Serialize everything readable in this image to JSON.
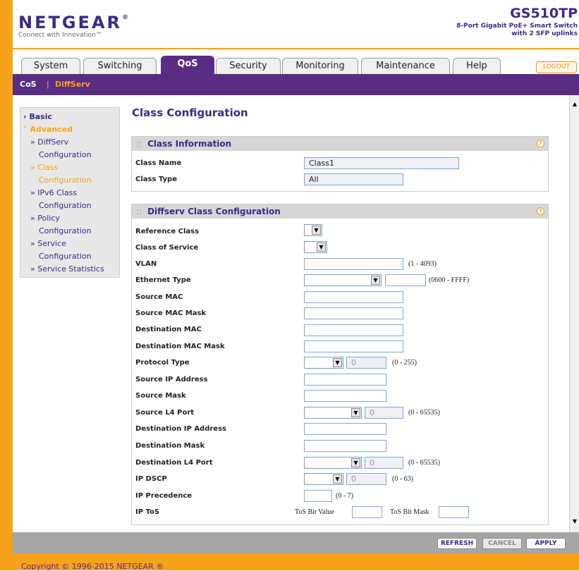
{
  "brand": {
    "logo": "NETGEAR",
    "reg": "®",
    "tagline": "Connect with Innovation™"
  },
  "product": {
    "model": "GS510TP",
    "desc1": "8-Port Gigabit PoE+ Smart Switch",
    "desc2": "with 2 SFP uplinks"
  },
  "tabs": [
    {
      "label": "System"
    },
    {
      "label": "Switching"
    },
    {
      "label": "QoS"
    },
    {
      "label": "Security"
    },
    {
      "label": "Monitoring"
    },
    {
      "label": "Maintenance"
    },
    {
      "label": "Help"
    }
  ],
  "logout_label": "LOGOUT",
  "subnav": {
    "cos": "CoS",
    "sep": "|",
    "diffserv": "DiffServ"
  },
  "sidebar": {
    "basic": "Basic",
    "advanced": "Advanced",
    "items": [
      {
        "line1": "DiffServ",
        "line2": "Configuration"
      },
      {
        "line1": "Class",
        "line2": "Configuration"
      },
      {
        "line1": "IPv6 Class",
        "line2": "Configuration"
      },
      {
        "line1": "Policy",
        "line2": "Configuration"
      },
      {
        "line1": "Service",
        "line2": "Configuration"
      },
      {
        "line1": "Service Statistics",
        "line2": ""
      }
    ]
  },
  "page_title": "Class Configuration",
  "class_info": {
    "title": "Class Information",
    "name_label": "Class Name",
    "name_value": "Class1",
    "type_label": "Class Type",
    "type_value": "All"
  },
  "diffserv": {
    "title": "Diffserv Class Configuration",
    "reference_class": "Reference Class",
    "class_of_service": "Class of Service",
    "vlan": "VLAN",
    "vlan_range": "(1 - 4093)",
    "ethernet_type": "Ethernet Type",
    "ethernet_range": "(0600 - FFFF)",
    "source_mac": "Source MAC",
    "source_mac_mask": "Source MAC Mask",
    "destination_mac": "Destination MAC",
    "destination_mac_mask": "Destination MAC Mask",
    "protocol_type": "Protocol Type",
    "protocol_value": "0",
    "protocol_range": "(0 - 255)",
    "source_ip": "Source IP Address",
    "source_mask": "Source Mask",
    "source_l4_port": "Source L4 Port",
    "source_l4_value": "0",
    "source_l4_range": "(0 - 65535)",
    "destination_ip": "Destination IP Address",
    "destination_mask": "Destination Mask",
    "destination_l4_port": "Destination L4 Port",
    "destination_l4_value": "0",
    "destination_l4_range": "(0 - 65535)",
    "ip_dscp": "IP DSCP",
    "ip_dscp_value": "0",
    "ip_dscp_range": "(0 - 63)",
    "ip_precedence": "IP Precedence",
    "ip_precedence_range": "(0 - 7)",
    "ip_tos": "IP ToS",
    "tos_bit_value": "ToS Bit Value",
    "tos_bit_mask": "ToS Bit Mask"
  },
  "buttons": {
    "refresh": "REFRESH",
    "cancel": "CANCEL",
    "apply": "APPLY"
  },
  "copyright": "Copyright © 1996-2015 NETGEAR ®",
  "colors": {
    "orange": "#f7a21b",
    "purple": "#5a2d82",
    "navy": "#3d2a86"
  }
}
